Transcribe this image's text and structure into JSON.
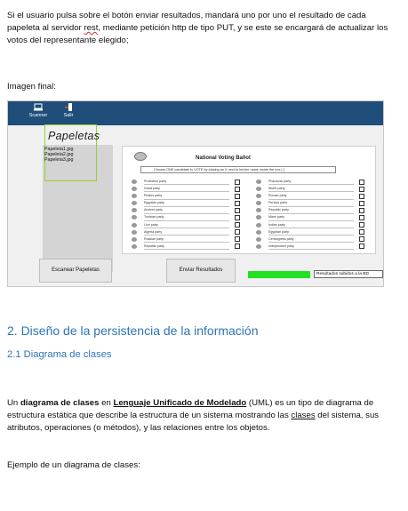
{
  "doc": {
    "para1_a": "Si el usuario pulsa sobre el botón enviar resultados, mandará uno por uno el resultado de cada papeleta al servidor ",
    "para1_rest": "rest",
    "para1_b": ", mediante petición http de tipo PUT, y se este se encargará de actualizar los votos del representante elegido;",
    "para2": "Imagen final:",
    "heading1": "2. Diseño de la persistencia de la información",
    "heading2": "2.1 Diagrama de clases",
    "para3_a": "Un ",
    "para3_bold": "diagrama de clases",
    "para3_b": " en ",
    "para3_link": "Lenguaje Unificado de Modelado",
    "para3_c": " (UML) es un tipo de diagrama de estructura estática que describe la estructura de un sistema mostrando las ",
    "para3_link2": "clases",
    "para3_d": " del sistema, sus atributos, operaciones (o métodos), y las relaciones entre los objetos.",
    "para4": "Ejemplo de un diagrama de clases:"
  },
  "screenshot": {
    "ribbon": [
      {
        "label": "Scanner",
        "icon": "scanner-icon"
      },
      {
        "label": "Salir",
        "icon": "exit-icon"
      }
    ],
    "panel_title": "Papeletas",
    "files": [
      "Papeleta1.jpg",
      "Papeleta2.jpg",
      "Papeleta3.jpg"
    ],
    "ballot_title": "National Voting Ballot",
    "ballot_instruction": "Choose ONE candidate to VOTE by placing an X next to his/her name inside the box [ ]",
    "ballot_left": [
      "Protection party",
      "Great party",
      "Pirates party",
      "Egyptian party",
      "Ancient party",
      "Tunisian party",
      "Lion party",
      "Algeria party",
      "Russian party",
      "Republic party"
    ],
    "ballot_right": [
      "Pharaonic party",
      "Worth party",
      "Roman party",
      "Persian party",
      "Republic party",
      "Maori party",
      "Indian party",
      "Egyptian party",
      "Centurgress party",
      "Independent party"
    ],
    "scan_button": "Escanear Papeletas",
    "send_button": "Enviar Resultados",
    "progress": 1.0,
    "status_text": "Resultados subidos a la BD",
    "accent": "#1e4e79",
    "progress_color": "#22e022"
  }
}
